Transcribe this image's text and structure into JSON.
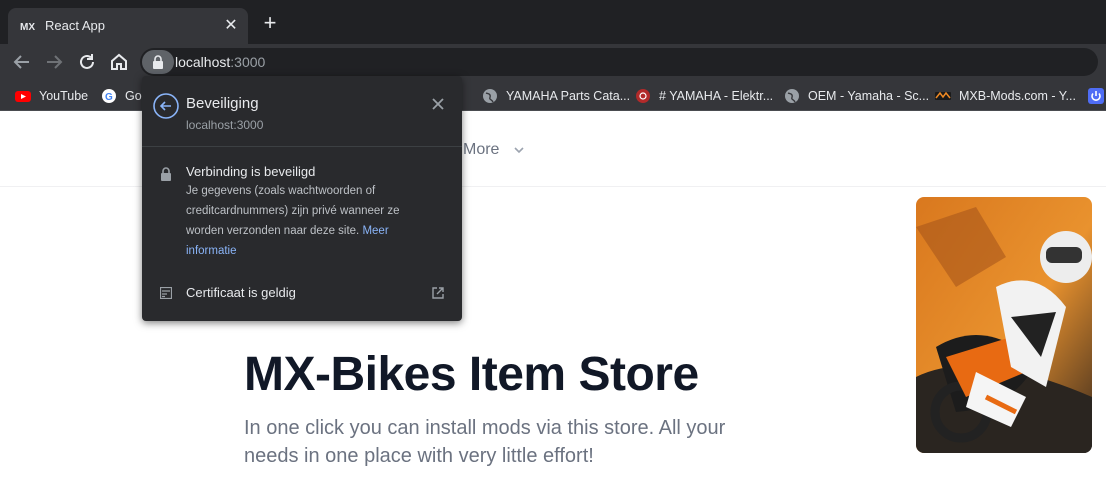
{
  "tab": {
    "title": "React App",
    "favicon": "mx-logo-icon"
  },
  "address": {
    "host": "localhost",
    "port": ":3000"
  },
  "bookmarks": [
    {
      "label": "YouTube",
      "icon": "youtube-icon"
    },
    {
      "label": "Go",
      "icon": "google-icon"
    },
    {
      "label": "YAMAHA Parts Cata...",
      "icon": "globe-icon"
    },
    {
      "label": "# YAMAHA - Elektr...",
      "icon": "yamaha-icon"
    },
    {
      "label": "OEM - Yamaha - Sc...",
      "icon": "globe-icon"
    },
    {
      "label": "MXB-Mods.com - Y...",
      "icon": "mxb-icon"
    }
  ],
  "popup": {
    "title": "Beveiliging",
    "subtitle": "localhost:3000",
    "connection_title": "Verbinding is beveiligd",
    "connection_desc": "Je gegevens (zoals wachtwoorden of creditcardnummers) zijn privé wanneer ze worden verzonden naar deze site.",
    "connection_link": "Meer informatie",
    "certificate_label": "Certificaat is geldig"
  },
  "page": {
    "nav_more": "More",
    "hero_title": "MX-Bikes Item Store",
    "hero_text": "In one click you can install mods via this store. All your needs in one place with very little effort!"
  },
  "colors": {
    "chrome_bg": "#202124",
    "toolbar_bg": "#35363a",
    "popup_bg": "#292a2d",
    "link": "#8ab4f8",
    "title": "#111827",
    "muted": "#6b7280"
  }
}
